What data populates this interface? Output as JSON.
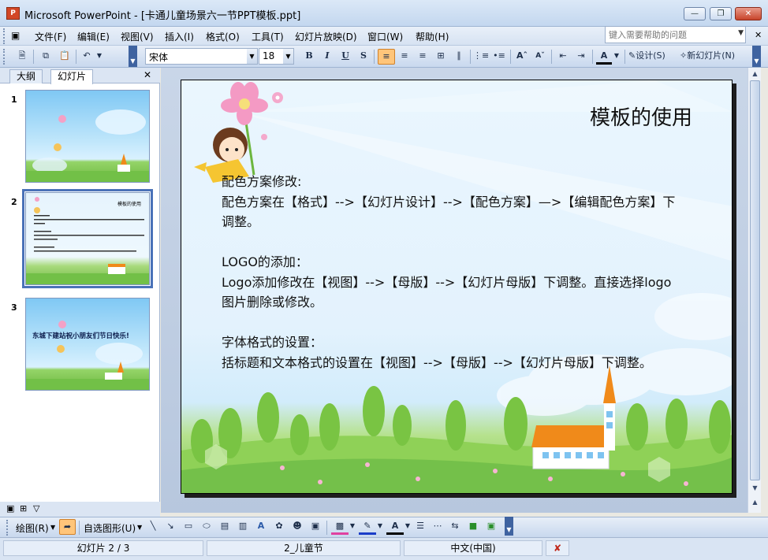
{
  "window": {
    "title": "Microsoft PowerPoint - [卡通儿童场景六一节PPT模板.ppt]",
    "app_icon_text": "P"
  },
  "menu": {
    "items": [
      "文件(F)",
      "编辑(E)",
      "视图(V)",
      "插入(I)",
      "格式(O)",
      "工具(T)",
      "幻灯片放映(D)",
      "窗口(W)",
      "帮助(H)"
    ],
    "help_placeholder": "键入需要帮助的问题"
  },
  "toolbar": {
    "font_name": "宋体",
    "font_size": "18",
    "bold": "B",
    "italic": "I",
    "underline": "U",
    "shadow": "S",
    "design_label": "设计(S)",
    "new_slide_label": "新幻灯片(N)"
  },
  "left_pane": {
    "tabs": [
      "大纲",
      "幻灯片"
    ],
    "active_tab": "幻灯片",
    "thumbnails": [
      {
        "number": "1",
        "text": ""
      },
      {
        "number": "2",
        "text": "模板的使用"
      },
      {
        "number": "3",
        "text": "东城下建站祝小朋友们节日快乐!"
      }
    ]
  },
  "slide": {
    "title": "模板的使用",
    "body": [
      "配色方案修改:",
      "配色方案在【格式】-->【幻灯片设计】-->【配色方案】—>【编辑配色方案】下",
      "调整。",
      "",
      "LOGO的添加：",
      "Logo添加修改在【视图】-->【母版】-->【幻灯片母版】下调整。直接选择logo",
      "图片删除或修改。",
      "",
      "字体格式的设置：",
      "括标题和文本格式的设置在【视图】-->【母版】-->【幻灯片母版】下调整。"
    ]
  },
  "drawing_toolbar": {
    "draw_label": "绘图(R)",
    "autoshapes_label": "自选图形(U)"
  },
  "status": {
    "slide_info": "幻灯片 2 / 3",
    "design_name": "2_儿童节",
    "language": "中文(中国)"
  },
  "colors": {
    "accent": "#4a72b8",
    "sky": "#e3f2fd",
    "grass": "#7fc54a",
    "roof": "#f08a1a"
  }
}
